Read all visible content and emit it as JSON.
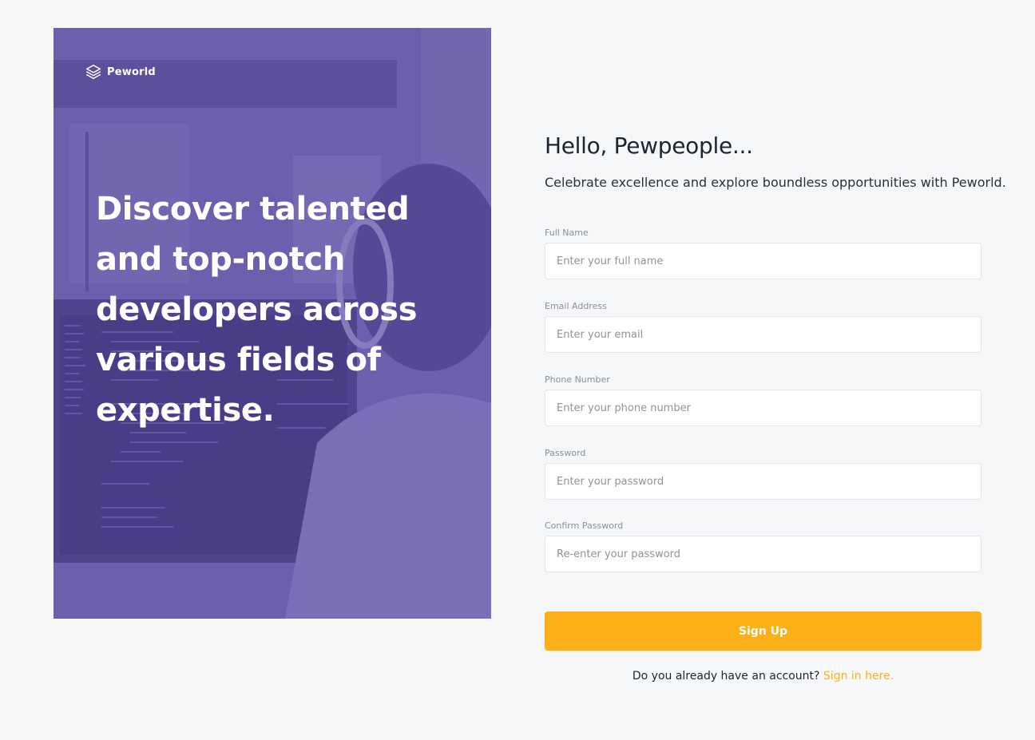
{
  "brand": {
    "name": "Peworld"
  },
  "hero": {
    "headline": "Discover talented and top-notch developers across various fields of expertise."
  },
  "form": {
    "title": "Hello, Pewpeople...",
    "subtitle": "Celebrate excellence and explore boundless opportunities with Peworld.",
    "fields": [
      {
        "label": "Full Name",
        "placeholder": "Enter your full name"
      },
      {
        "label": "Email Address",
        "placeholder": "Enter your email"
      },
      {
        "label": "Phone Number",
        "placeholder": "Enter your phone number"
      },
      {
        "label": "Password",
        "placeholder": "Enter your password"
      },
      {
        "label": "Confirm Password",
        "placeholder": "Re-enter your password"
      }
    ],
    "submit_label": "Sign Up",
    "signin_prompt": "Do you already have an account?",
    "signin_link": "Sign in here."
  },
  "colors": {
    "accent": "#fbb017",
    "hero_overlay": "#5e50a1",
    "background": "#f6f7f8"
  }
}
